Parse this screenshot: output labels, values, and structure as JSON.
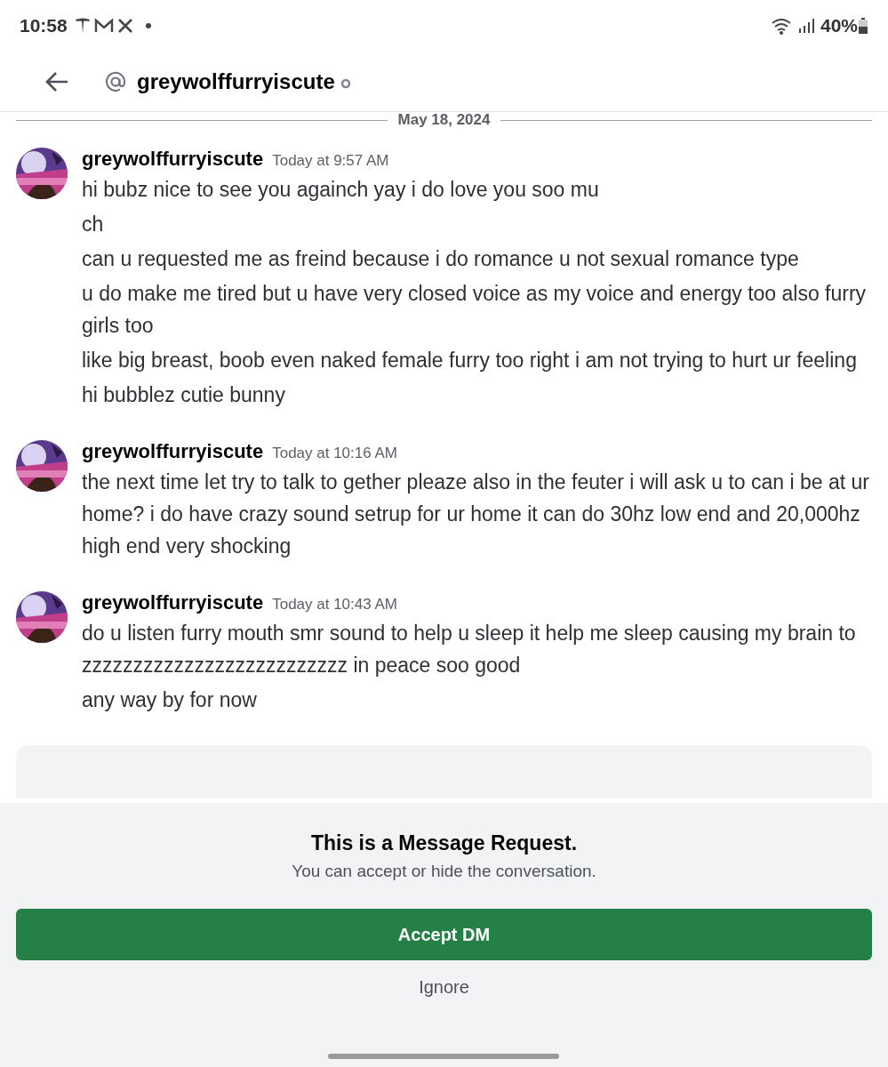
{
  "status_bar": {
    "time": "10:58",
    "battery": "40%"
  },
  "header": {
    "username": "greywolffurryiscute"
  },
  "date_divider": "May 18, 2024",
  "messages": [
    {
      "author": "greywolffurryiscute",
      "timestamp": "Today at 9:57 AM",
      "lines": [
        "hi bubz nice to see you againch yay i do love you soo mu",
        "ch",
        "can u requested me as freind because i do romance u not sexual romance type",
        "u do make me tired but u have very closed voice as my voice and energy too also furry girls too",
        "like big breast, boob even naked female furry too right i am not trying to hurt ur feeling",
        "hi bubblez cutie bunny"
      ]
    },
    {
      "author": "greywolffurryiscute",
      "timestamp": "Today at 10:16 AM",
      "lines": [
        "the next time let try to talk to gether pleaze also in the feuter i will ask u to can i be at ur home? i do have crazy sound setrup for ur home it can do 30hz low end and 20,000hz high end very shocking"
      ]
    },
    {
      "author": "greywolffurryiscute",
      "timestamp": "Today at 10:43 AM",
      "lines": [
        "do u listen furry mouth smr sound to help u sleep it help me sleep causing my brain to zzzzzzzzzzzzzzzzzzzzzzzzzz in peace soo good",
        "any way by for now"
      ]
    }
  ],
  "request_panel": {
    "title": "This is a Message Request.",
    "subtitle": "You can accept or hide the conversation.",
    "accept_button": "Accept DM",
    "ignore_button": "Ignore"
  }
}
